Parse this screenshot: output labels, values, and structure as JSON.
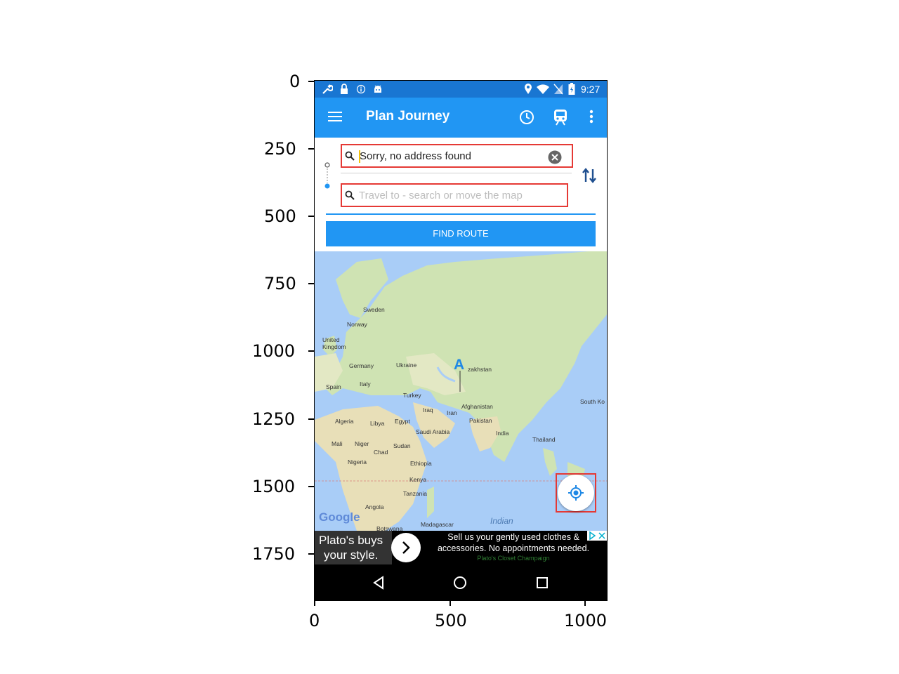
{
  "status_bar": {
    "time": "9:27"
  },
  "app_bar": {
    "title": "Plan Journey"
  },
  "journey": {
    "from_value": "Sorry, no address found",
    "to_placeholder": "Travel to - search or move the map",
    "find_route_label": "FIND ROUTE"
  },
  "map": {
    "marker_label": "A",
    "attribution": "Google",
    "place_labels": {
      "sweden": "Sweden",
      "norway": "Norway",
      "uk": "United Kingdom",
      "germany": "Germany",
      "ukraine": "Ukraine",
      "kazakhstan": "zakhstan",
      "spain": "Spain",
      "italy": "Italy",
      "turkey": "Turkey",
      "iraq": "Iraq",
      "iran": "Iran",
      "afghanistan": "Afghanistan",
      "pakistan": "Pakistan",
      "india": "India",
      "algeria": "Algeria",
      "libya": "Libya",
      "egypt": "Egypt",
      "saudi": "Saudi Arabia",
      "mali": "Mali",
      "niger": "Niger",
      "chad": "Chad",
      "sudan": "Sudan",
      "nigeria": "Nigeria",
      "ethiopia": "Ethiopia",
      "kenya": "Kenya",
      "tanzania": "Tanzania",
      "angola": "Angola",
      "botswana": "Botswana",
      "madagascar": "Madagascar",
      "indian_ocean": "Indian",
      "thailand": "Thailand",
      "south_korea": "South Ko"
    }
  },
  "ad": {
    "headline_line1": "Plato's buys",
    "headline_line2": "your style.",
    "body_line1": "Sell us your gently used clothes &",
    "body_line2": "accessories. No appointments needed.",
    "advertiser": "Plato's Closet Champaign"
  },
  "plot": {
    "y_ticks": [
      "0",
      "250",
      "500",
      "750",
      "1000",
      "1250",
      "1500",
      "1750"
    ],
    "x_ticks": [
      "0",
      "500",
      "1000"
    ]
  },
  "colors": {
    "primary": "#2196f3",
    "status_bar": "#1976d2",
    "highlight": "#e53935",
    "water": "#a9cdf7",
    "land": "#cfe3b3"
  }
}
